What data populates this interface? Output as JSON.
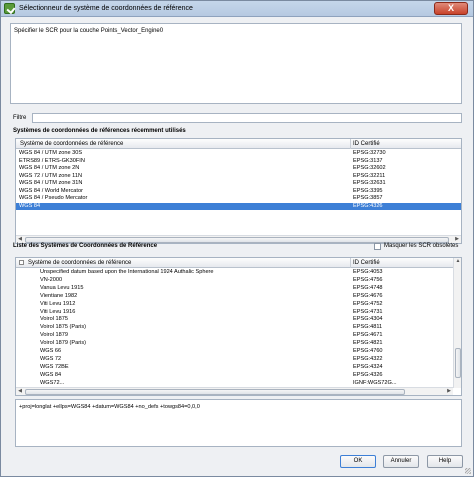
{
  "window": {
    "title": "Sélectionneur de système de coordonnées de référence",
    "close_label": "X"
  },
  "description": "Spécifier le SCR pour la couche Points_Vector_Engine0",
  "filter": {
    "label": "Filtre",
    "value": ""
  },
  "recent": {
    "title": "Systèmes de coordonnées de références récemment utilisés",
    "col_name": "Système de coordonnées de référence",
    "col_id": "ID Certifié",
    "rows": [
      {
        "name": "WGS 84 / UTM zone 30S",
        "id": "EPSG:32730",
        "selected": false
      },
      {
        "name": "ETRS89 / ETRS-GK30FIN",
        "id": "EPSG:3137",
        "selected": false
      },
      {
        "name": "WGS 84 / UTM zone 2N",
        "id": "EPSG:32602",
        "selected": false
      },
      {
        "name": "WGS 72 / UTM zone 11N",
        "id": "EPSG:32211",
        "selected": false
      },
      {
        "name": "WGS 84 / UTM zone 31N",
        "id": "EPSG:32631",
        "selected": false
      },
      {
        "name": "WGS 84 / World Mercator",
        "id": "EPSG:3395",
        "selected": false
      },
      {
        "name": "WGS 84 / Pseudo Mercator",
        "id": "EPSG:3857",
        "selected": false
      },
      {
        "name": "WGS 84",
        "id": "EPSG:4326",
        "selected": true
      }
    ]
  },
  "list": {
    "title": "Liste des Systèmes de Coordonnées de Référence",
    "hide_obsolete_label": "Masquer les SCR obsolètes",
    "hide_obsolete_checked": false,
    "col_name": "Système de coordonnées de référence",
    "col_id": "ID Certifié",
    "rows": [
      {
        "name": "Unspecified datum based upon the International 1924 Authalic Sphere",
        "id": "EPSG:4053"
      },
      {
        "name": "VN-2000",
        "id": "EPSG:4756"
      },
      {
        "name": "Vanua Levu 1915",
        "id": "EPSG:4748"
      },
      {
        "name": "Vientiane 1982",
        "id": "EPSG:4676"
      },
      {
        "name": "Viti Levu 1912",
        "id": "EPSG:4752"
      },
      {
        "name": "Viti Levu 1916",
        "id": "EPSG:4731"
      },
      {
        "name": "Voirol 1875",
        "id": "EPSG:4304"
      },
      {
        "name": "Voirol 1875 (Paris)",
        "id": "EPSG:4811"
      },
      {
        "name": "Voirol 1879",
        "id": "EPSG:4671"
      },
      {
        "name": "Voirol 1879 (Paris)",
        "id": "EPSG:4821"
      },
      {
        "name": "WGS 66",
        "id": "EPSG:4760"
      },
      {
        "name": "WGS 72",
        "id": "EPSG:4322"
      },
      {
        "name": "WGS 72BE",
        "id": "EPSG:4324"
      },
      {
        "name": "WGS 84",
        "id": "EPSG:4326"
      },
      {
        "name": "WGS72...",
        "id": "IGNF:WGS72G..."
      }
    ]
  },
  "proj_string": "+proj=longlat +ellps=WGS84 +datum=WGS84 +no_defs +towgs84=0,0,0",
  "buttons": {
    "ok": "OK",
    "cancel": "Annuler",
    "help": "Help"
  }
}
